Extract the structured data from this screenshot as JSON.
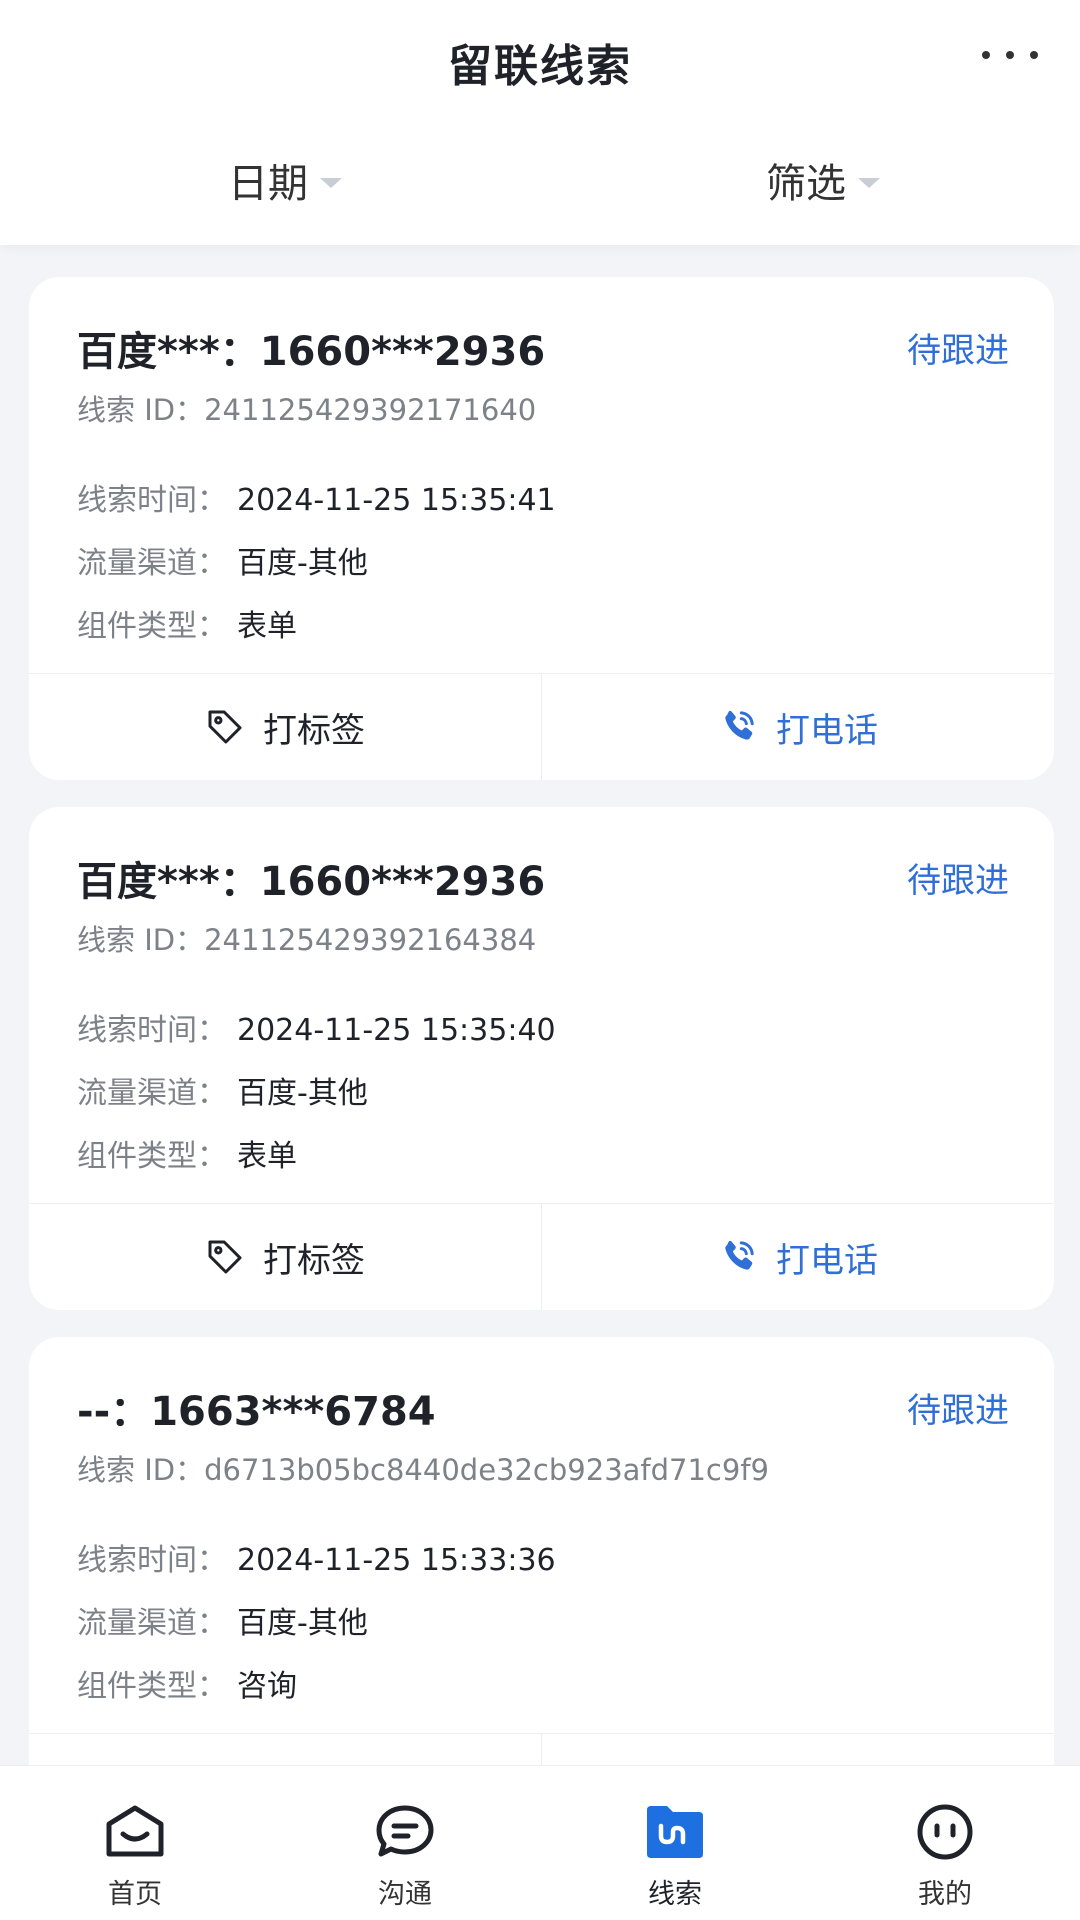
{
  "header": {
    "title": "留联线索",
    "filters": [
      {
        "label": "日期"
      },
      {
        "label": "筛选"
      }
    ]
  },
  "labels": {
    "id_prefix": "线索 ID：",
    "time": "线索时间：",
    "channel": "流量渠道：",
    "component": "组件类型："
  },
  "actions": {
    "tag": "打标签",
    "call": "打电话"
  },
  "leads": [
    {
      "title": "百度***：1660***2936",
      "status": "待跟进",
      "id": "241125429392171640",
      "time": "2024-11-25 15:35:41",
      "channel": "百度-其他",
      "component": "表单"
    },
    {
      "title": "百度***：1660***2936",
      "status": "待跟进",
      "id": "241125429392164384",
      "time": "2024-11-25 15:35:40",
      "channel": "百度-其他",
      "component": "表单"
    },
    {
      "title": "--：1663***6784",
      "status": "待跟进",
      "id": "d6713b05bc8440de32cb923afd71c9f9",
      "time": "2024-11-25 15:33:36",
      "channel": "百度-其他",
      "component": "咨询"
    }
  ],
  "nav": [
    {
      "label": "首页",
      "icon": "home-icon"
    },
    {
      "label": "沟通",
      "icon": "chat-icon"
    },
    {
      "label": "线索",
      "icon": "leads-icon",
      "active": true
    },
    {
      "label": "我的",
      "icon": "profile-icon"
    }
  ],
  "colors": {
    "accent": "#2f6fd6",
    "nav_active": "#1e6fe0"
  }
}
